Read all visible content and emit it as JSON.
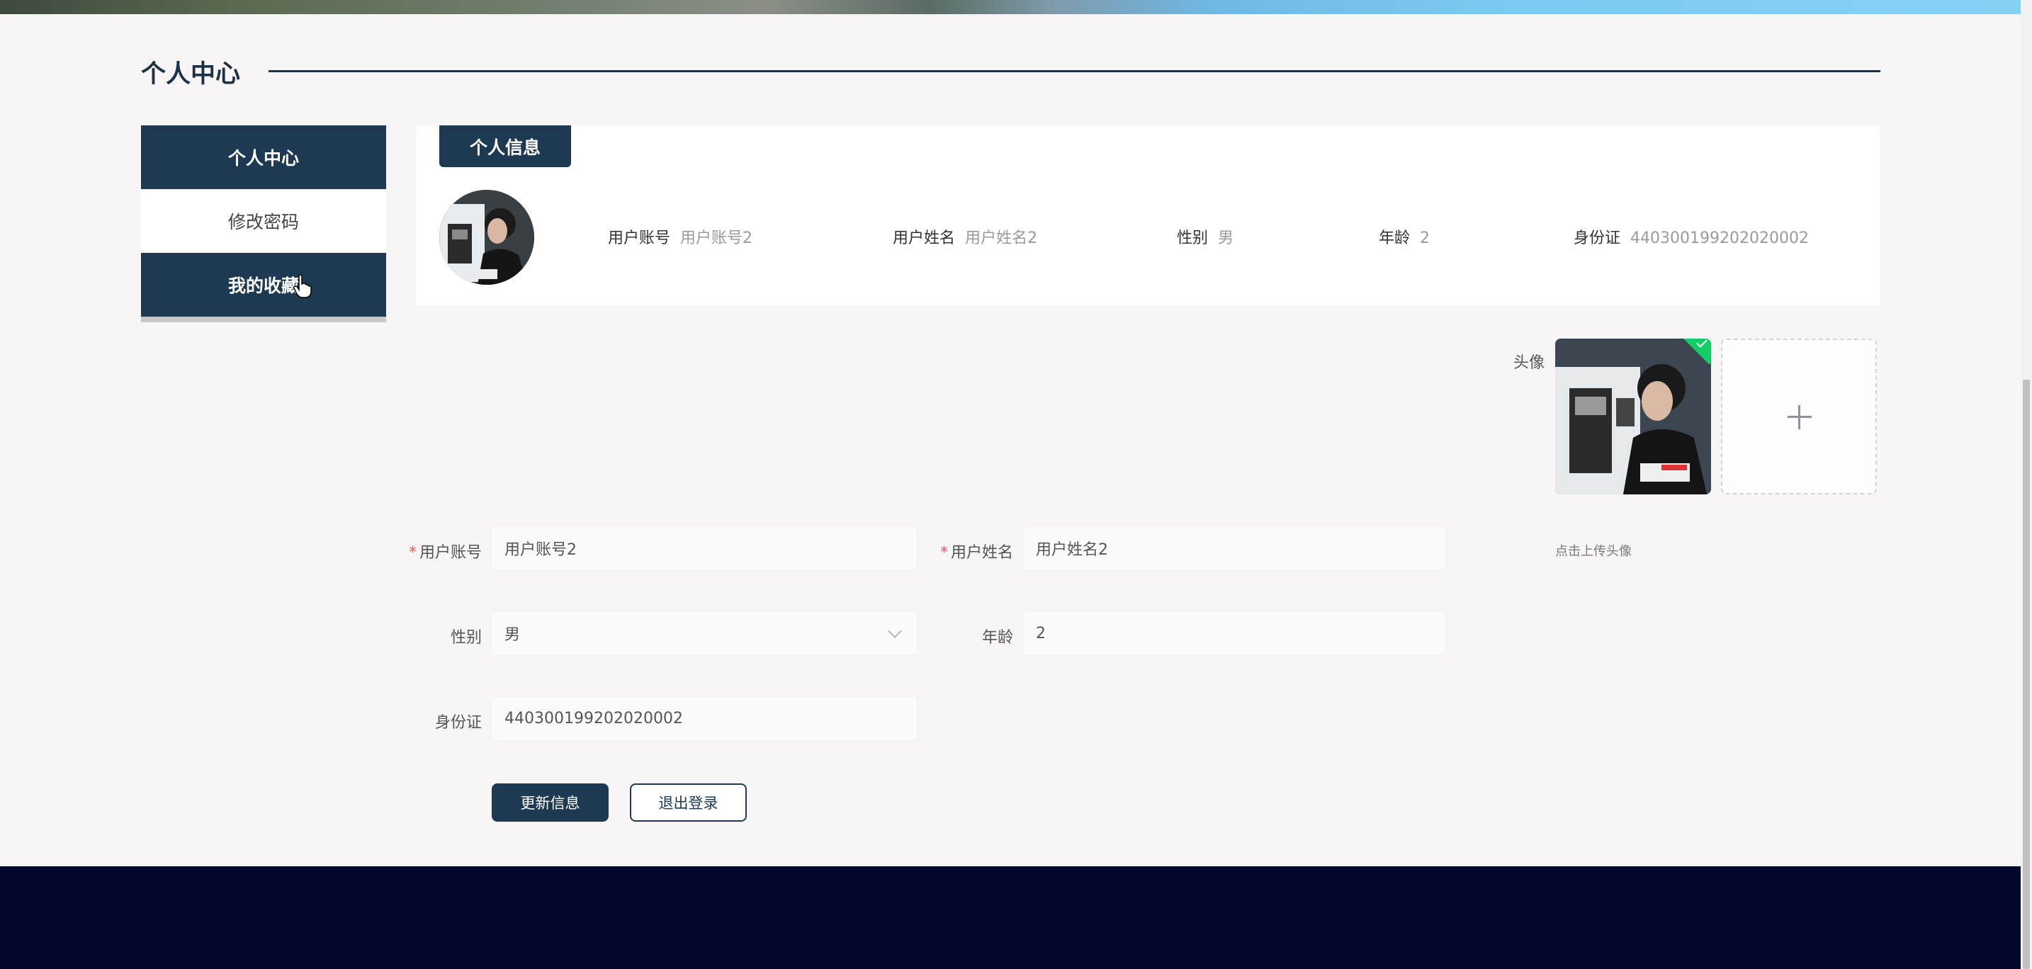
{
  "section": {
    "title": "个人中心"
  },
  "sidebar": {
    "items": [
      {
        "label": "个人中心",
        "active": true
      },
      {
        "label": "修改密码",
        "active": false
      },
      {
        "label": "我的收藏",
        "active": true
      }
    ]
  },
  "info_card": {
    "tab_label": "个人信息",
    "fields": [
      {
        "key": "用户账号",
        "value": "用户账号2"
      },
      {
        "key": "用户姓名",
        "value": "用户姓名2"
      },
      {
        "key": "性别",
        "value": "男"
      },
      {
        "key": "年龄",
        "value": "2"
      },
      {
        "key": "身份证",
        "value": "440300199202020002"
      }
    ]
  },
  "form": {
    "account": {
      "label": "用户账号",
      "required_mark": "*",
      "value": "用户账号2"
    },
    "name": {
      "label": "用户姓名",
      "required_mark": "*",
      "value": "用户姓名2"
    },
    "gender": {
      "label": "性别",
      "value": "男"
    },
    "age": {
      "label": "年龄",
      "value": "2"
    },
    "id_card": {
      "label": "身份证",
      "value": "440300199202020002"
    },
    "avatar": {
      "label": "头像",
      "upload_tip": "点击上传头像",
      "add_icon": "plus-icon",
      "status_icon": "check-icon"
    }
  },
  "buttons": {
    "update": "更新信息",
    "logout": "退出登录"
  },
  "colors": {
    "primary": "#1d3a52",
    "footer": "#03072b",
    "success": "#13ce66",
    "required": "#e85a5a"
  }
}
